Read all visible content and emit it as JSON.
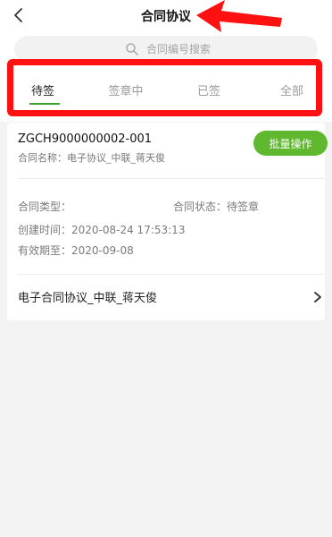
{
  "header": {
    "title": "合同协议"
  },
  "search": {
    "placeholder": "合同编号搜索"
  },
  "tabs": [
    {
      "label": "待签",
      "active": true
    },
    {
      "label": "签章中",
      "active": false
    },
    {
      "label": "已签",
      "active": false
    },
    {
      "label": "全部",
      "active": false
    }
  ],
  "contract": {
    "number": "ZGCH9000000002-001",
    "name_line": "合同名称：电子协议_中联_蒋天俊",
    "batch_button": "批量操作",
    "type_line": "合同类型：",
    "status_line": "合同状态：待签章",
    "created_line": "创建时间：2020-08-24 17:53:13",
    "valid_line": "有效期至：2020-09-08",
    "doc_title": "电子合同协议_中联_蒋天俊"
  },
  "colors": {
    "accent_green": "#5fb82e",
    "annotation_red": "#ff1111",
    "background": "#f3f3f3"
  },
  "icons": {
    "back": "chevron-left-icon",
    "search": "search-icon",
    "more": "chevron-right-icon",
    "annotation": "red-arrow-icon"
  }
}
